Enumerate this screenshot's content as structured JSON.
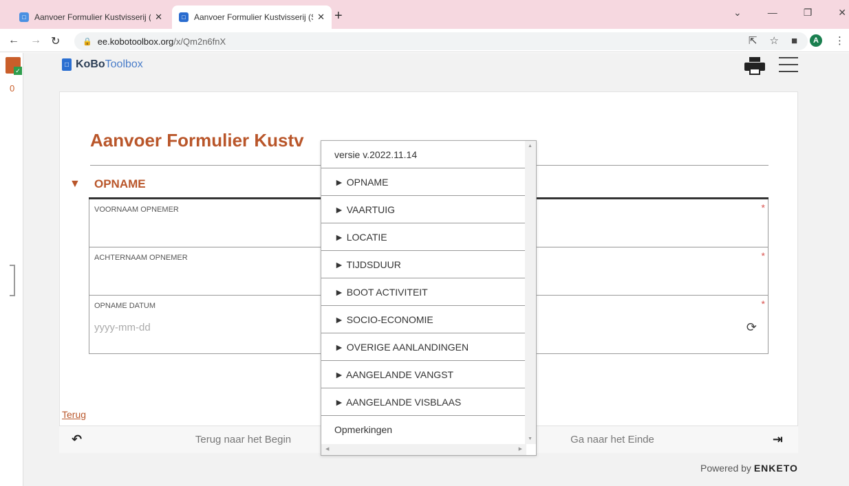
{
  "browser": {
    "tabs": [
      {
        "title": "Aanvoer Formulier Kustvisserij (S",
        "close": "✕"
      },
      {
        "title": "Aanvoer Formulier Kustvisserij (S",
        "close": "✕"
      }
    ],
    "new_tab": "+",
    "url_host": "ee.kobotoolbox.org",
    "url_path": "/x/Qm2n6fnX",
    "profile_initial": "A"
  },
  "sidebar": {
    "queue_count": "0"
  },
  "header": {
    "logo_kobo": "KoBo",
    "logo_toolbox": "Toolbox"
  },
  "form": {
    "title": "Aanvoer Formulier Kustv",
    "group_label": "OPNAME",
    "questions": [
      {
        "label": "VOORNAAM OPNEMER",
        "required": "*"
      },
      {
        "label": "ACHTERNAAM OPNEMER",
        "required": "*"
      },
      {
        "label": "OPNAME DATUM",
        "required": "*",
        "placeholder": "yyyy-mm-dd"
      }
    ]
  },
  "dropdown": {
    "items": [
      "versie v.2022.11.14",
      "► OPNAME",
      "► VAARTUIG",
      "► LOCATIE",
      "► TIJDSDUUR",
      "► BOOT ACTIVITEIT",
      "► SOCIO-ECONOMIE",
      "► OVERIGE AANLANDINGEN",
      "► AANGELANDE VANGST",
      "► AANGELANDE VISBLAAS",
      "Opmerkingen"
    ]
  },
  "footer": {
    "back_link": "Terug",
    "nav_start": "Terug naar het Begin",
    "nav_end": "Ga naar het Einde",
    "powered_by": "Powered by",
    "powered_brand": "ENKETO"
  },
  "colors": {
    "accent": "#b9562a",
    "required": "#d9534f",
    "tab_strip": "#f6d8e0"
  }
}
